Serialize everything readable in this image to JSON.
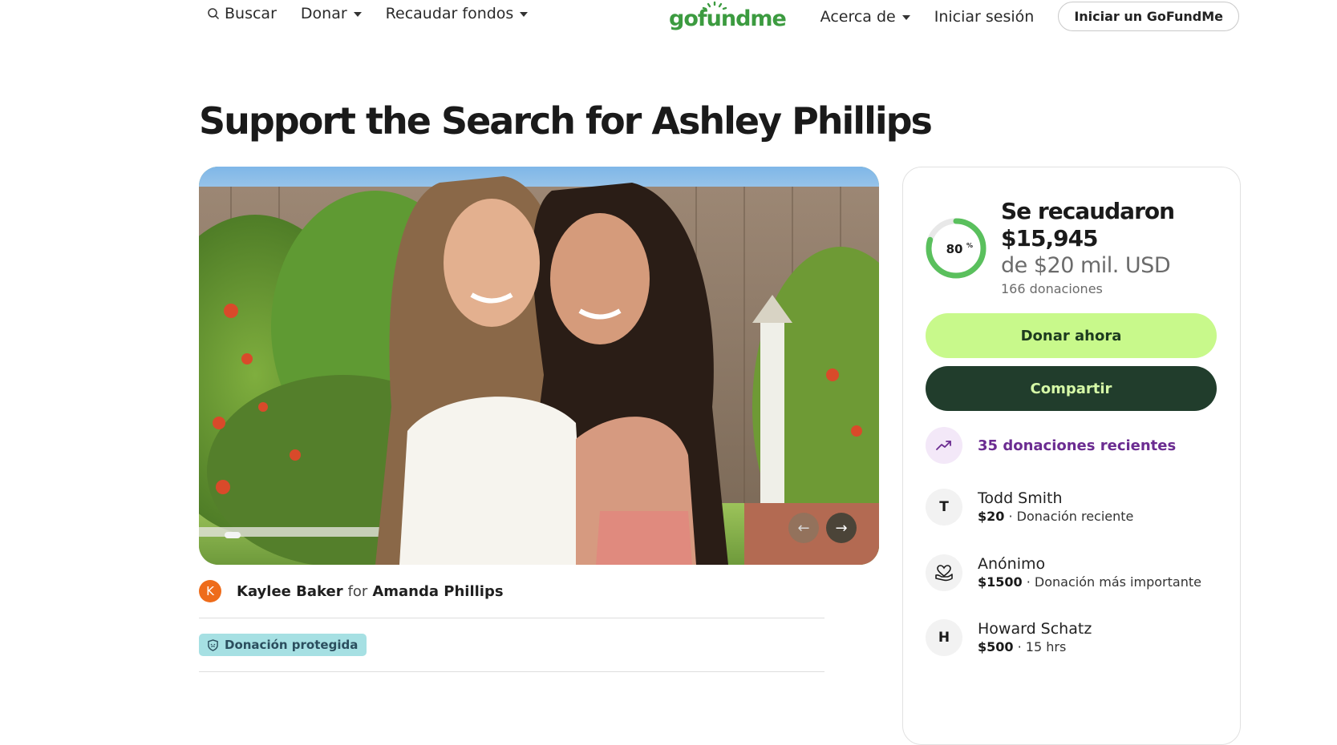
{
  "nav": {
    "search_label": "Buscar",
    "donate_label": "Donar",
    "fundraise_label": "Recaudar fondos",
    "logo_text": "gofundme",
    "about_label": "Acerca de",
    "signin_label": "Iniciar sesión",
    "start_label": "Iniciar un GoFundMe"
  },
  "campaign": {
    "title": "Support the Search for Ashley Phillips",
    "organizer_initial": "K",
    "organizer_name": "Kaylee Baker",
    "for_word": "for",
    "beneficiary": "Amanda Phillips",
    "protected_label": "Donación protegida",
    "carousel_prev": "←",
    "carousel_next": "→"
  },
  "card": {
    "progress_percent": 80,
    "progress_label": "80",
    "progress_suffix": "%",
    "raised_label": "Se recaudaron",
    "raised_amount": "$15,945",
    "goal_text": "de $20 mil. USD",
    "donations_count": "166 donaciones",
    "donate_button": "Donar ahora",
    "share_button": "Compartir",
    "recent_label": "35 donaciones recientes",
    "donors": [
      {
        "initial": "T",
        "name": "Todd Smith",
        "amount": "$20",
        "note": " · Donación reciente"
      },
      {
        "initial": "",
        "name": "Anónimo",
        "amount": "$1500",
        "note": " · Donación más importante"
      },
      {
        "initial": "H",
        "name": "Howard Schatz",
        "amount": "$500",
        "note": " · 15 hrs"
      }
    ]
  },
  "colors": {
    "brand_green": "#3c9b40",
    "progress_green": "#5ac05d",
    "donate_bg": "#c8f98b",
    "share_bg": "#213d2c",
    "recent_purple": "#6b2c91"
  }
}
